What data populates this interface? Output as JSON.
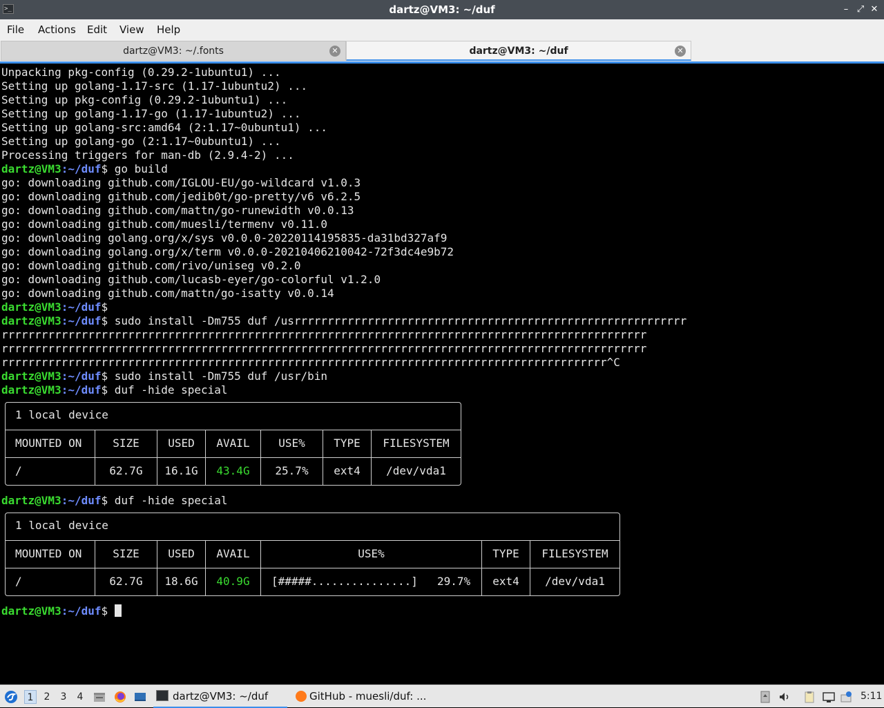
{
  "window": {
    "title": "dartz@VM3: ~/duf"
  },
  "menu": {
    "file": "File",
    "actions": "Actions",
    "edit": "Edit",
    "view": "View",
    "help": "Help"
  },
  "tabs": [
    {
      "label": "dartz@VM3: ~/.fonts"
    },
    {
      "label": "dartz@VM3: ~/duf"
    }
  ],
  "prompt": {
    "user": "dartz@VM3",
    "path": ":~/duf",
    "dollar": "$"
  },
  "terminal": {
    "apt_lines": [
      "Unpacking pkg-config (0.29.2-1ubuntu1) ...",
      "Setting up golang-1.17-src (1.17-1ubuntu2) ...",
      "Setting up pkg-config (0.29.2-1ubuntu1) ...",
      "Setting up golang-1.17-go (1.17-1ubuntu2) ...",
      "Setting up golang-src:amd64 (2:1.17~0ubuntu1) ...",
      "Setting up golang-go (2:1.17~0ubuntu1) ...",
      "Processing triggers for man-db (2.9.4-2) ..."
    ],
    "cmd_build": " go build",
    "go_lines": [
      "go: downloading github.com/IGLOU-EU/go-wildcard v1.0.3",
      "go: downloading github.com/jedib0t/go-pretty/v6 v6.2.5",
      "go: downloading github.com/mattn/go-runewidth v0.0.13",
      "go: downloading github.com/muesli/termenv v0.11.0",
      "go: downloading golang.org/x/sys v0.0.0-20220114195835-da31bd327af9",
      "go: downloading golang.org/x/term v0.0.0-20210406210042-72f3dc4e9b72",
      "go: downloading github.com/rivo/uniseg v0.2.0",
      "go: downloading github.com/lucasb-eyer/go-colorful v1.2.0",
      "go: downloading github.com/mattn/go-isatty v0.0.14"
    ],
    "cmd_empty": "",
    "cmd_install_bad": " sudo install -Dm755 duf /usrrrrrrrrrrrrrrrrrrrrrrrrrrrrrrrrrrrrrrrrrrrrrrrrrrrrrrrrrrr",
    "wrap_lines": [
      "rrrrrrrrrrrrrrrrrrrrrrrrrrrrrrrrrrrrrrrrrrrrrrrrrrrrrrrrrrrrrrrrrrrrrrrrrrrrrrrrrrrrrrrrrrrrrrrrr",
      "rrrrrrrrrrrrrrrrrrrrrrrrrrrrrrrrrrrrrrrrrrrrrrrrrrrrrrrrrrrrrrrrrrrrrrrrrrrrrrrrrrrrrrrrrrrrrrrrr",
      "rrrrrrrrrrrrrrrrrrrrrrrrrrrrrrrrrrrrrrrrrrrrrrrrrrrrrrrrrrrrrrrrrrrrrrrrrrrrrrrrrrrrrrrrrrr^C"
    ],
    "cmd_install": " sudo install -Dm755 duf /usr/bin",
    "cmd_duf": " duf -hide special",
    "cmd_last": " "
  },
  "duf1": {
    "title": "1 local device",
    "headers": [
      "MOUNTED ON",
      "SIZE",
      "USED",
      "AVAIL",
      "USE%",
      "TYPE",
      "FILESYSTEM"
    ],
    "row": {
      "mount": "/",
      "size": "62.7G",
      "used": "16.1G",
      "avail": "43.4G",
      "use_pct": "25.7%",
      "type": "ext4",
      "fs": "/dev/vda1"
    }
  },
  "duf2": {
    "title": "1 local device",
    "headers": [
      "MOUNTED ON",
      "SIZE",
      "USED",
      "AVAIL",
      "USE%",
      "TYPE",
      "FILESYSTEM"
    ],
    "row": {
      "mount": "/",
      "size": "62.7G",
      "used": "18.6G",
      "avail": "40.9G",
      "use_bar": "[#####...............]",
      "use_pct": "29.7%",
      "type": "ext4",
      "fs": "/dev/vda1"
    }
  },
  "taskbar": {
    "workspaces": [
      "1",
      "2",
      "3",
      "4"
    ],
    "tasks": [
      {
        "label": "dartz@VM3: ~/duf"
      },
      {
        "label": "GitHub - muesli/duf: ..."
      }
    ],
    "clock": "5:11"
  }
}
